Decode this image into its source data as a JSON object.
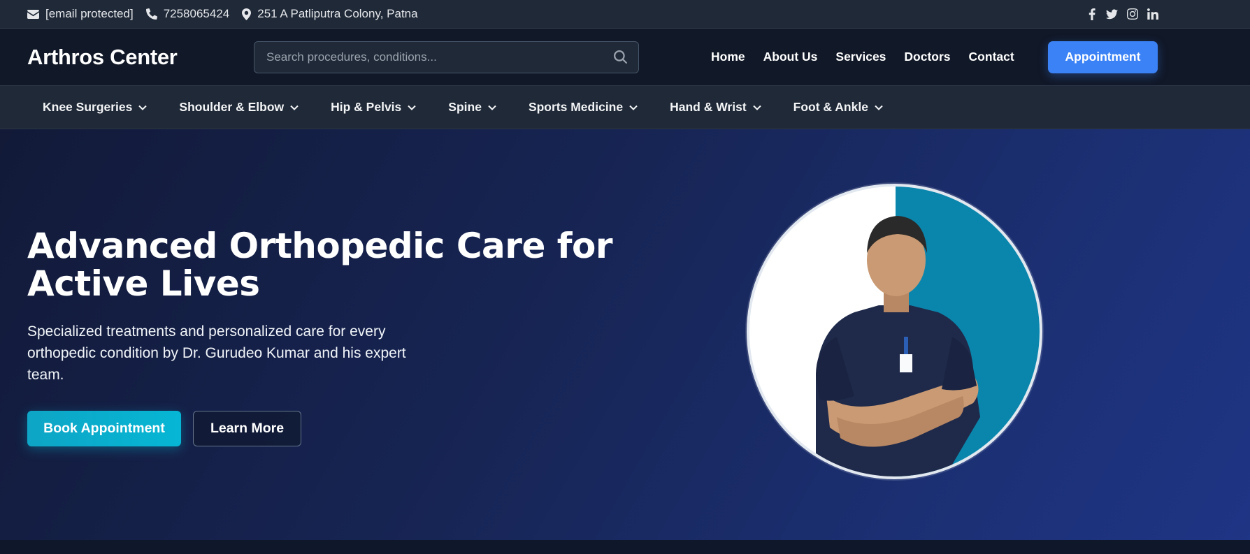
{
  "topbar": {
    "email": "[email protected]",
    "phone": "7258065424",
    "address": "251 A Patliputra Colony, Patna",
    "social": [
      "facebook-icon",
      "twitter-icon",
      "instagram-icon",
      "linkedin-icon"
    ]
  },
  "header": {
    "logo": "Arthros Center",
    "search_placeholder": "Search procedures, conditions...",
    "nav": [
      "Home",
      "About Us",
      "Services",
      "Doctors",
      "Contact"
    ],
    "cta": "Appointment"
  },
  "categories": [
    "Knee Surgeries",
    "Shoulder & Elbow",
    "Hip & Pelvis",
    "Spine",
    "Sports Medicine",
    "Hand & Wrist",
    "Foot & Ankle"
  ],
  "hero": {
    "title_line1": "Advanced Orthopedic Care for",
    "title_line2": "Active Lives",
    "subtitle": "Specialized treatments and personalized care for every orthopedic condition by Dr. Gurudeo Kumar and his expert team.",
    "primary_button": "Book Appointment",
    "secondary_button": "Learn More"
  },
  "colors": {
    "accent": "#3b82f6",
    "cta_teal": "#06b6d4",
    "hero_bg": "#172555"
  }
}
